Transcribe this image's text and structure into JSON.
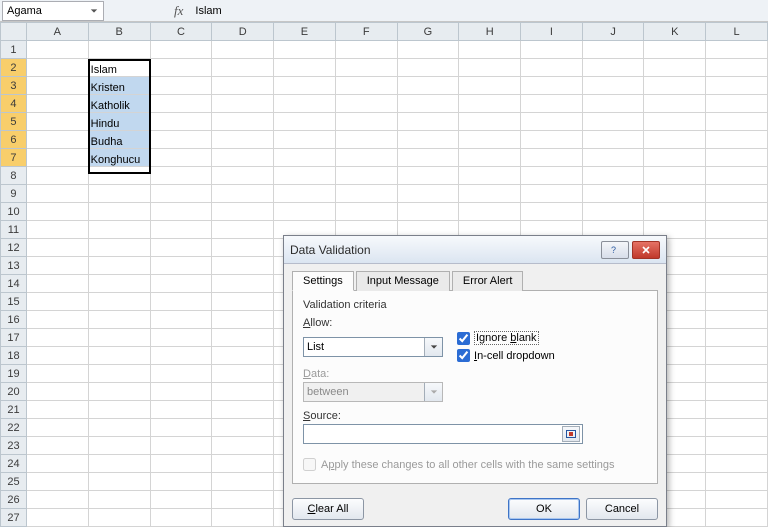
{
  "namebox": {
    "value": "Agama"
  },
  "formula": {
    "fx_label": "fx",
    "value": "Islam"
  },
  "columns": [
    "A",
    "B",
    "C",
    "D",
    "E",
    "F",
    "G",
    "H",
    "I",
    "J",
    "K",
    "L"
  ],
  "rows_visible": 27,
  "selected_rows": [
    2,
    3,
    4,
    5,
    6,
    7
  ],
  "cells": {
    "B2": "Islam",
    "B3": "Kristen",
    "B4": "Katholik",
    "B5": "Hindu",
    "B6": "Budha",
    "B7": "Konghucu"
  },
  "dialog": {
    "title": "Data Validation",
    "tabs": {
      "settings": "Settings",
      "input_message": "Input Message",
      "error_alert": "Error Alert"
    },
    "active_tab": "settings",
    "criteria_label": "Validation criteria",
    "allow_label": "Allow:",
    "allow_value": "List",
    "data_label": "Data:",
    "data_value": "between",
    "source_label": "Source:",
    "source_value": "",
    "ignore_blank_label": "Ignore blank",
    "ignore_blank_checked": true,
    "incell_label": "In-cell dropdown",
    "incell_checked": true,
    "apply_label": "Apply these changes to all other cells with the same settings",
    "apply_checked": false,
    "buttons": {
      "clear_all": "Clear All",
      "ok": "OK",
      "cancel": "Cancel"
    }
  }
}
